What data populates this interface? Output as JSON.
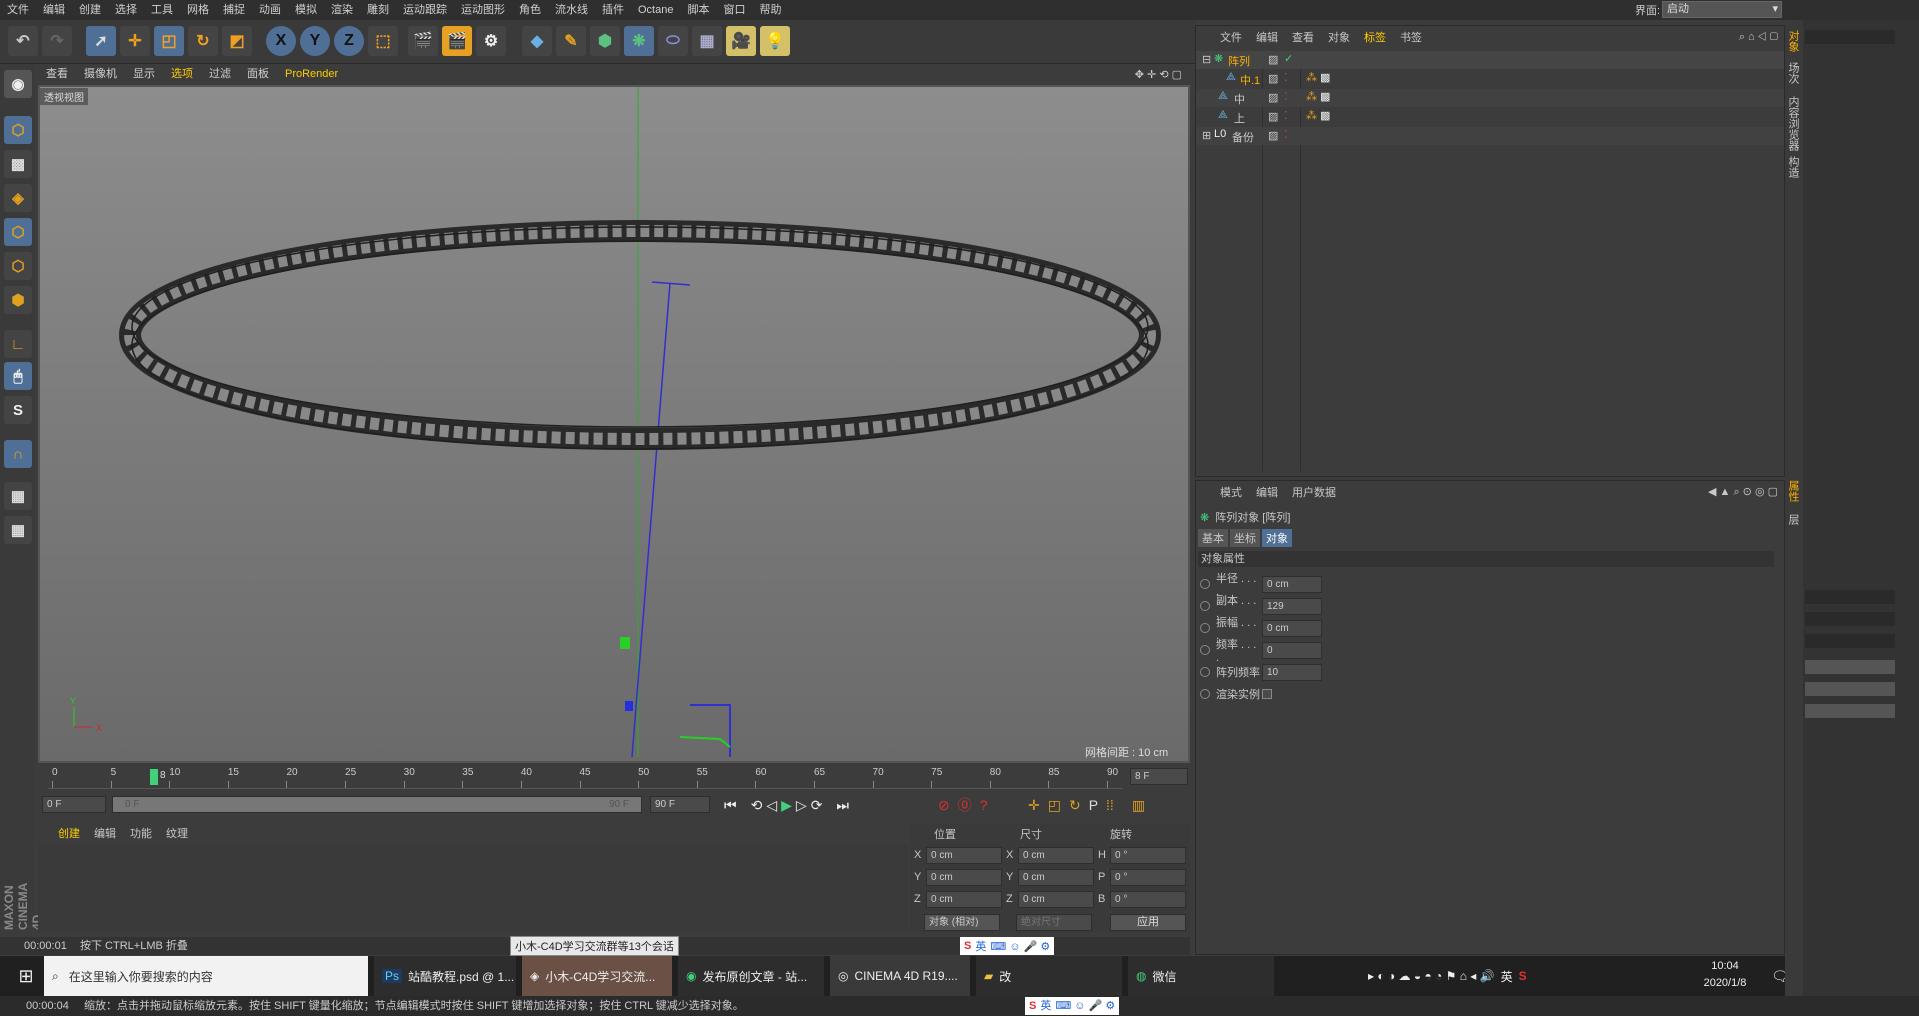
{
  "menubar": {
    "items": [
      "文件",
      "编辑",
      "创建",
      "选择",
      "工具",
      "网格",
      "捕捉",
      "动画",
      "模拟",
      "渲染",
      "雕刻",
      "运动跟踪",
      "运动图形",
      "角色",
      "流水线",
      "插件",
      "Octane",
      "脚本",
      "窗口",
      "帮助"
    ],
    "layout_label": "界面:",
    "layout_value": "启动"
  },
  "viewport": {
    "menu": [
      "查看",
      "摄像机",
      "显示",
      "选项",
      "过滤",
      "面板",
      "ProRender"
    ],
    "label": "透视视图",
    "grid_spacing": "网格间距 : 10 cm",
    "axis_y": "Y",
    "axis_x": "X"
  },
  "timeline": {
    "ticks": [
      "0",
      "5",
      "10",
      "15",
      "20",
      "25",
      "30",
      "35",
      "40",
      "45",
      "50",
      "55",
      "60",
      "65",
      "70",
      "75",
      "80",
      "85",
      "90"
    ],
    "current_frame_marker": "8",
    "frame_field": "8 F"
  },
  "anim_bar": {
    "start": "0 F",
    "range_start": "0 F",
    "range_end": "90 F",
    "end": "90 F"
  },
  "material_panel": {
    "tabs": [
      "创建",
      "编辑",
      "功能",
      "纹理"
    ]
  },
  "coord_panel": {
    "headers": [
      "位置",
      "尺寸",
      "旋转"
    ],
    "rows": [
      {
        "a": "X",
        "pos": "0 cm",
        "b": "X",
        "size": "0 cm",
        "c": "H",
        "rot": "0 °"
      },
      {
        "a": "Y",
        "pos": "0 cm",
        "b": "Y",
        "size": "0 cm",
        "c": "P",
        "rot": "0 °"
      },
      {
        "a": "Z",
        "pos": "0 cm",
        "b": "Z",
        "size": "0 cm",
        "c": "B",
        "rot": "0 °"
      }
    ],
    "mode_select": "对象 (相对)",
    "size_select": "绝对尺寸",
    "apply_label": "应用"
  },
  "status": {
    "time": "00:00:01",
    "text": "按下 CTRL+LMB 折叠",
    "tooltip": "小木-C4D学习交流群等13个会话"
  },
  "footer": {
    "time": "00:00:04",
    "text": "缩放：点击并拖动鼠标缩放元素。按住 SHIFT 键量化缩放；节点编辑模式时按住 SHIFT 键增加选择对象；按住 CTRL 键减少选择对象。"
  },
  "taskbar": {
    "search_placeholder": "在这里输入你要搜索的内容",
    "apps": [
      "站酷教程.psd @ 1...",
      "小木-C4D学习交流...",
      "发布原创文章 - 站...",
      "CINEMA 4D R19....",
      "改",
      "微信"
    ],
    "ime": "英",
    "tray_lang": "英",
    "clock_time": "10:04",
    "clock_date": "2020/1/8"
  },
  "object_manager": {
    "menu": [
      "文件",
      "编辑",
      "查看",
      "对象",
      "标签",
      "书签"
    ],
    "objects": [
      {
        "name": "阵列",
        "indent": 0
      },
      {
        "name": "中.1",
        "indent": 1
      },
      {
        "name": "中",
        "indent": 1
      },
      {
        "name": "上",
        "indent": 1
      },
      {
        "name": "备份",
        "indent": 0
      }
    ]
  },
  "attribute_manager": {
    "menu": [
      "模式",
      "编辑",
      "用户数据"
    ],
    "title": "阵列对象 [阵列]",
    "tabs": [
      "基本",
      "坐标",
      "对象"
    ],
    "section": "对象属性",
    "props": [
      {
        "label": "半径 . . . .",
        "value": "0 cm"
      },
      {
        "label": "副本 . . . .",
        "value": "129"
      },
      {
        "label": "振幅 . . . .",
        "value": "0 cm"
      },
      {
        "label": "频率 . . . .",
        "value": "0"
      },
      {
        "label": "阵列频率",
        "value": "10"
      },
      {
        "label": "渲染实例",
        "value": ""
      }
    ]
  },
  "right_tabs": [
    "对象",
    "场次",
    "内容浏览器",
    "构造",
    "属性",
    "层"
  ],
  "colors": {
    "accent": "#ffb000",
    "active_blue": "#4f6f96",
    "bg": "#3c3c3c"
  }
}
